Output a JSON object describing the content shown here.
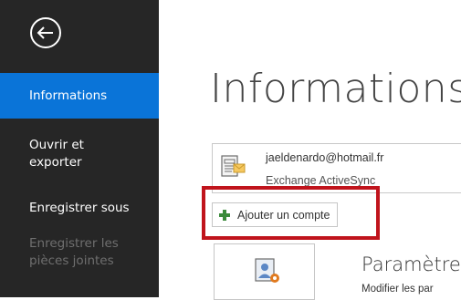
{
  "sidebar": {
    "back_icon": "back-arrow-icon",
    "items": [
      {
        "label": "Informations",
        "active": true
      },
      {
        "label": "Ouvrir et",
        "label2": "exporter"
      },
      {
        "label": "Enregistrer sous"
      },
      {
        "label": "Enregistrer les",
        "label2": "pièces jointes",
        "disabled": true
      }
    ],
    "background_color": "#262626",
    "active_color": "#0a74d8"
  },
  "main": {
    "title": "Informations",
    "account": {
      "email": "jaeldenardo@hotmail.fr",
      "type": "Exchange ActiveSync",
      "icon": "exchange-account-icon"
    },
    "add_account": {
      "label": "Ajouter un compte",
      "icon": "plus-icon",
      "highlight_color": "#c0141c"
    },
    "settings": {
      "title": "Paramètre",
      "description": "Modifier les par",
      "icon": "account-settings-icon"
    }
  }
}
